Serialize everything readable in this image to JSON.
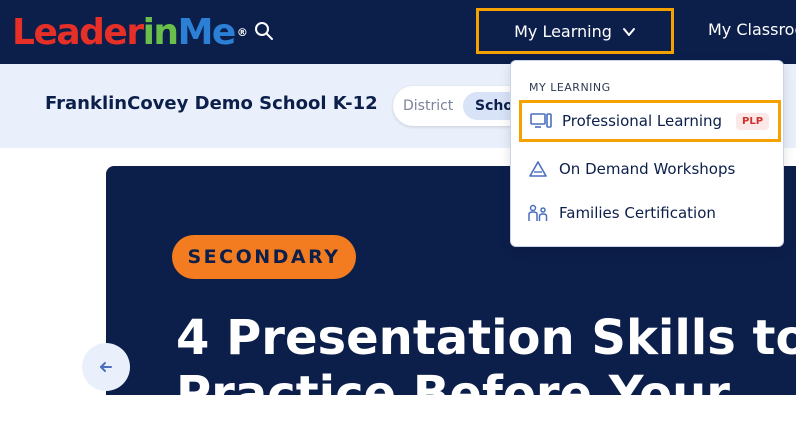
{
  "header": {
    "logo": {
      "leader": "Leader",
      "in": "in",
      "me": "Me",
      "reg": "®"
    },
    "my_learning_label": "My Learning",
    "my_classroom_label": "My Classroo"
  },
  "subheader": {
    "school_name": "FranklinCovey Demo School K-12",
    "toggle_district": "District",
    "toggle_school": "Scho"
  },
  "hero": {
    "badge": "SECONDARY",
    "title_line1": "4 Presentation Skills to",
    "title_line2": "Practice Before Your"
  },
  "dropdown": {
    "header": "MY LEARNING",
    "items": [
      {
        "label": "Professional Learning",
        "tag": "PLP",
        "icon": "monitor-icon"
      },
      {
        "label": "On Demand Workshops",
        "icon": "triangle-icon"
      },
      {
        "label": "Families Certification",
        "icon": "family-icon"
      }
    ]
  },
  "colors": {
    "navy": "#0c1f4b",
    "highlight": "#f5a100",
    "badge": "#f47c20",
    "logo_red": "#e63027",
    "logo_green": "#6abf4b",
    "logo_blue": "#2b7fd4"
  }
}
